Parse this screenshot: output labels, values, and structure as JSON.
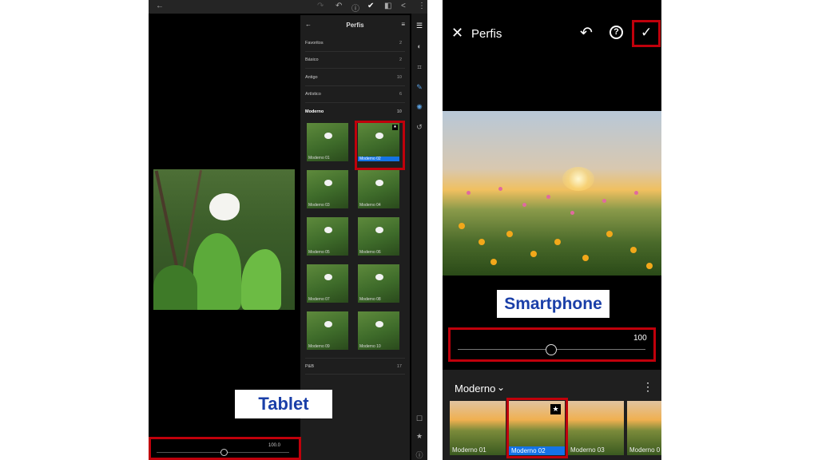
{
  "tablet": {
    "panel_title": "Perfis",
    "categories": [
      {
        "label": "Favoritos",
        "count": "2"
      },
      {
        "label": "Básico",
        "count": "2"
      },
      {
        "label": "Antigo",
        "count": "10"
      },
      {
        "label": "Artístico",
        "count": "6"
      },
      {
        "label": "Moderno",
        "count": "10"
      },
      {
        "label": "P&B",
        "count": "17"
      }
    ],
    "thumbs": [
      "Moderno 01",
      "Moderno 02",
      "Moderno 03",
      "Moderno 04",
      "Moderno 05",
      "Moderno 06",
      "Moderno 07",
      "Moderno 08",
      "Moderno 09",
      "Moderno 10"
    ],
    "slider_value": "100.0",
    "slider_level": 1.0,
    "caption": "Tablet"
  },
  "phone": {
    "title": "Perfis",
    "slider_value": "100",
    "slider_level": 1.0,
    "caption": "Smartphone",
    "group": "Moderno",
    "thumbs": [
      "Moderno 01",
      "Moderno 02",
      "Moderno 03",
      "Moderno 0"
    ]
  },
  "colors": {
    "accent": "#1473e6",
    "highlight": "#c0000b",
    "caption_text": "#1a3fa8"
  },
  "icons": [
    "back-arrow-icon",
    "undo-icon",
    "help-icon",
    "check-icon",
    "compare-icon",
    "share-icon",
    "more-icon",
    "menu-icon",
    "close-icon",
    "star-icon",
    "chevron-down-icon",
    "sliders-icon",
    "color-icon",
    "crop-icon",
    "brush-icon",
    "presets-icon",
    "history-icon",
    "comment-icon",
    "info-icon"
  ]
}
